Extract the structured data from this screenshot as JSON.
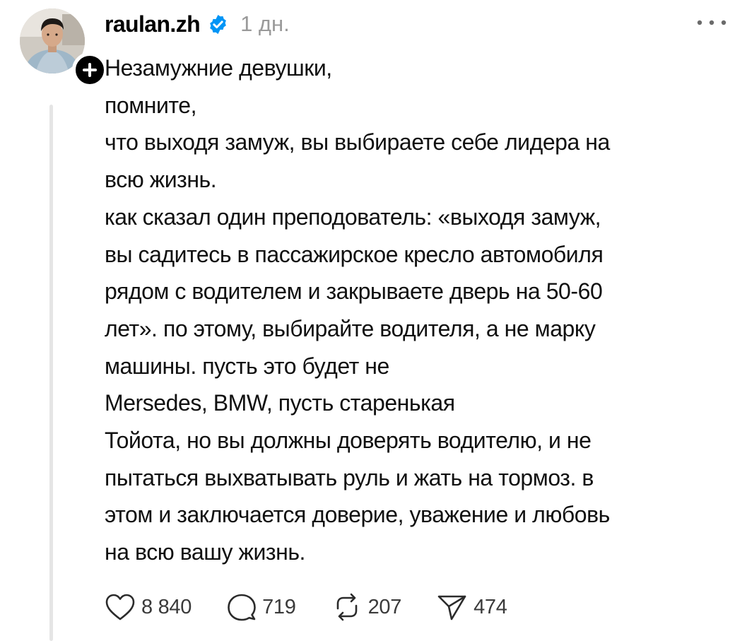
{
  "post": {
    "username": "raulan.zh",
    "timestamp": "1 дн.",
    "verified": true,
    "lines": [
      "Незамужние девушки,",
      "помните,",
      "что выходя замуж, вы выбираете себе лидера на",
      "всю жизнь.",
      "как сказал один преподователь: «выходя замуж,",
      "вы садитесь в пассажирское кресло автомобиля",
      "рядом с водителем и закрываете дверь на 50-60",
      "лет». по этому, выбирайте водителя, а не марку",
      "машины. пусть это будет не",
      "Mersedes, BMW, пусть старенькая",
      "Тойота, но вы должны доверять водителю, и не",
      "пытаться выхватывать руль и жать на тормоз. в",
      "этом и заключается доверие, уважение и любовь",
      "на всю вашу жизнь."
    ]
  },
  "actions": {
    "likes": "8 840",
    "replies": "719",
    "reposts": "207",
    "shares": "474"
  },
  "icons": {
    "verified": "verified-badge-icon",
    "follow": "plus-icon",
    "more": "ellipsis-icon",
    "like": "heart-icon",
    "reply": "speech-bubble-icon",
    "repost": "repost-arrows-icon",
    "share": "paper-plane-icon"
  },
  "colors": {
    "verified": "#0095f6",
    "text": "#101010",
    "muted": "#9a9a9a",
    "thread_line": "#e5e5e5"
  }
}
